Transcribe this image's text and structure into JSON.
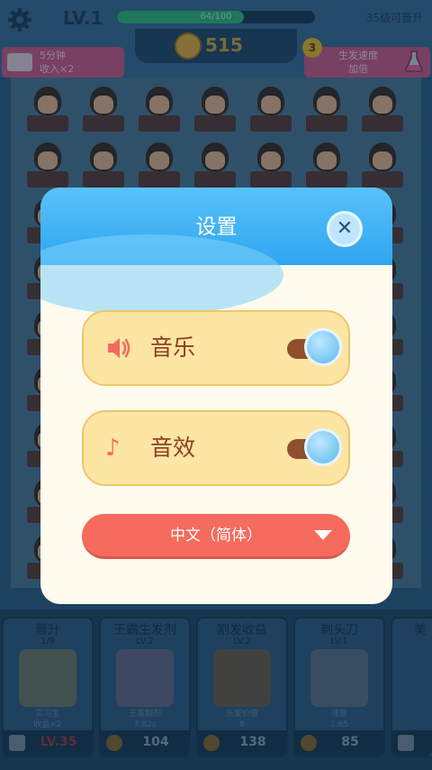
{
  "hud": {
    "level": "LV.1",
    "xp_text": "64/100",
    "xp_progress": 0.64,
    "promote_text": "35级可晋升",
    "coins": "515",
    "ad_bonus": {
      "line1": "5分钟",
      "line2": "收入×2"
    },
    "speed_boost": {
      "badge": "3",
      "line1": "生发速度",
      "line2": "加倍"
    }
  },
  "settings": {
    "title": "设置",
    "music_label": "音乐",
    "music_on": true,
    "sfx_label": "音效",
    "sfx_on": true,
    "language": "中文（简体）"
  },
  "shop": {
    "cards": [
      {
        "title": "晋升",
        "level": "1/9",
        "desc1": "实习生",
        "desc2": "收益×2",
        "price": "LV.35",
        "locked": true
      },
      {
        "title": "王霸生发剂",
        "level": "LV.2",
        "desc1": "王发制剂",
        "desc2": "7.82s",
        "price": "104",
        "locked": false
      },
      {
        "title": "割发收益",
        "level": "LV.2",
        "desc1": "头发价值",
        "desc2": "8",
        "price": "138",
        "locked": false
      },
      {
        "title": "剃头刀",
        "level": "LV.1",
        "desc1": "速度",
        "desc2": "1.65",
        "price": "85",
        "locked": false
      },
      {
        "title": "美",
        "level": "",
        "desc1": "",
        "desc2": "",
        "price": "",
        "locked": true
      }
    ]
  },
  "icons": {
    "settings": "gear-icon",
    "coin": "coin-icon",
    "ad": "video-ad-icon",
    "flask": "flask-icon",
    "close": "close-icon",
    "music": "speaker-icon",
    "sfx": "music-note-icon",
    "dropdown": "chevron-down-icon",
    "lock": "lock-icon"
  },
  "colors": {
    "modal_header": "#3fb2f5",
    "modal_body": "#fffbee",
    "row_fill": "#fde5a3",
    "language_button": "#f56b5e",
    "toggle_track": "#8f4f2d"
  }
}
